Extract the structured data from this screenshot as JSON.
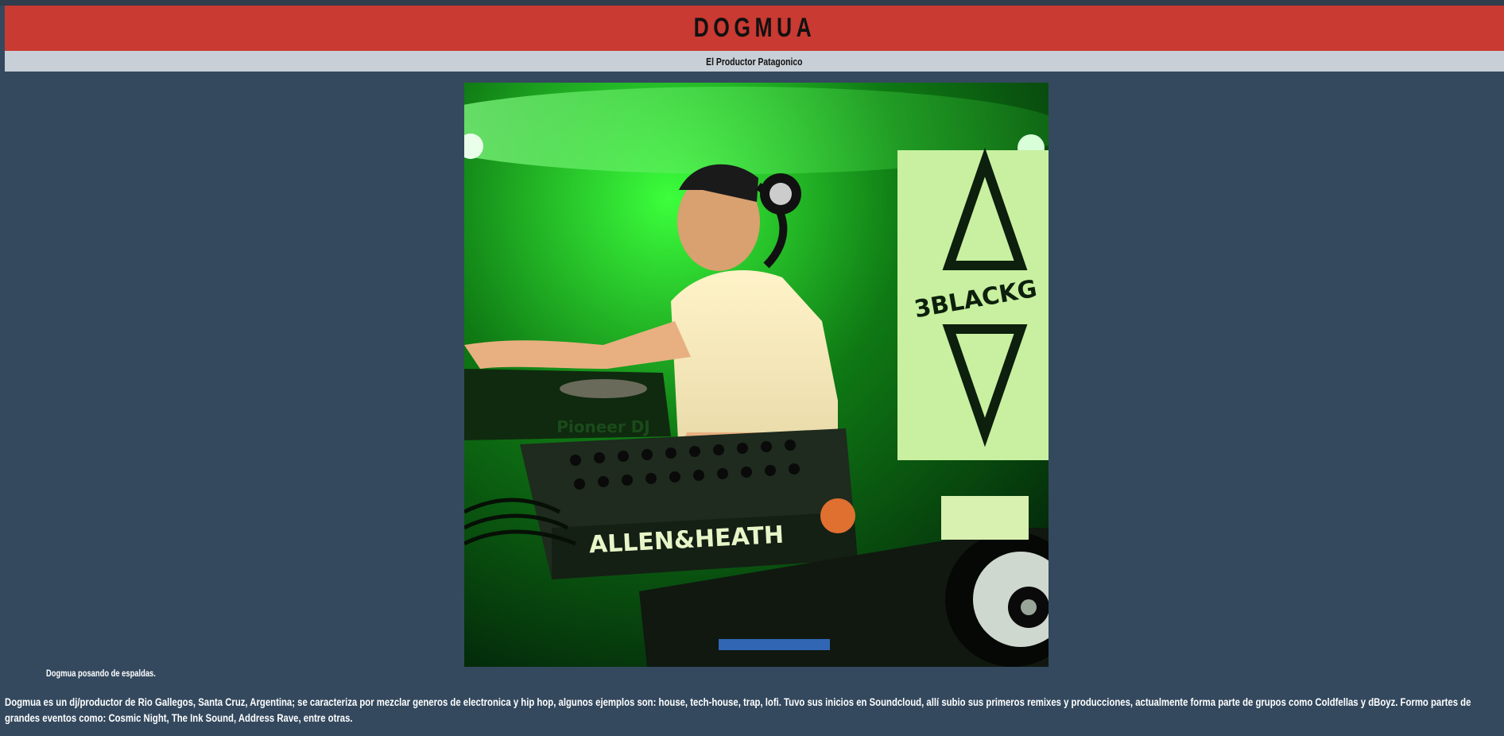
{
  "header": {
    "title": "DOGMUA"
  },
  "subtitle": "El Productor Patagonico",
  "photo": {
    "image_id": "dj-photo",
    "alt": "Dogmua posando de espaldas.",
    "banner_text": "3BLACKG",
    "mixer_brand": "ALLEN&HEATH",
    "deck_brand": "Pioneer DJ"
  },
  "caption": "Dogmua posando de espaldas.",
  "description": "Dogmua es un dj/productor de Rio Gallegos, Santa Cruz, Argentina; se caracteriza por mezclar generos de electronica y hip hop, algunos ejemplos son: house, tech-house, trap, lofi. Tuvo sus inicios en Soundcloud, allí subio sus primeros remixes y producciones, actualmente forma parte de grupos como Coldfellas y dBoyz. Formo partes de grandes eventos como: Cosmic Night, The Ink Sound, Address Rave, entre otras.",
  "colors": {
    "header": "#c93a32",
    "subbar": "#c8cfd6",
    "background": "#34495e"
  }
}
